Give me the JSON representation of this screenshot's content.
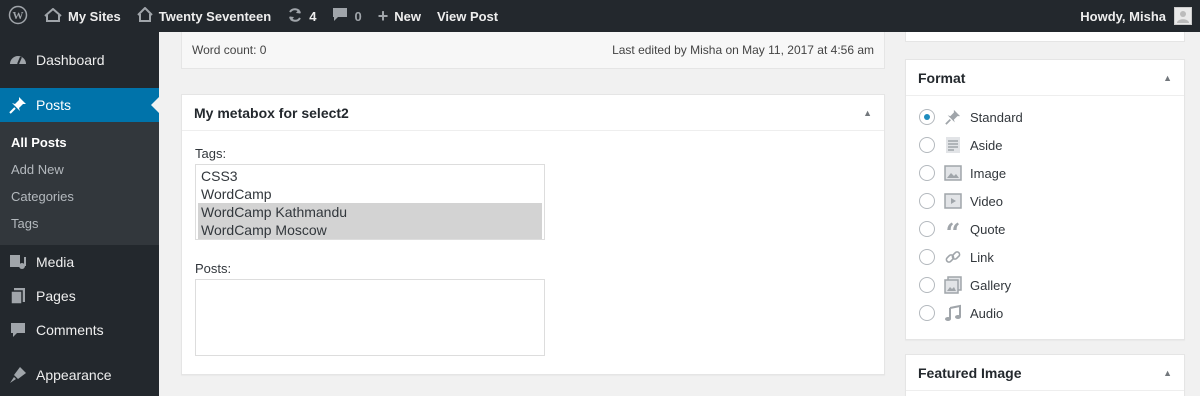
{
  "adminbar": {
    "wp_logo_icon": "wordpress-logo-icon",
    "my_sites": "My Sites",
    "site_name": "Twenty Seventeen",
    "updates_count": "4",
    "comments_count": "0",
    "new_label": "New",
    "view_post": "View Post",
    "howdy": "Howdy, Misha"
  },
  "sidebar": {
    "items": [
      {
        "label": "Dashboard",
        "icon": "dashboard-icon"
      },
      {
        "label": "Posts",
        "icon": "pushpin-icon"
      },
      {
        "label": "Media",
        "icon": "media-icon"
      },
      {
        "label": "Pages",
        "icon": "pages-icon"
      },
      {
        "label": "Comments",
        "icon": "comments-icon"
      },
      {
        "label": "Appearance",
        "icon": "appearance-icon"
      }
    ],
    "submenu": [
      "All Posts",
      "Add New",
      "Categories",
      "Tags"
    ]
  },
  "editor": {
    "word_count": "Word count: 0",
    "last_edited": "Last edited by Misha on May 11, 2017 at 4:56 am"
  },
  "metabox": {
    "title": "My metabox for select2",
    "tags_label": "Tags:",
    "tags_options": [
      "CSS3",
      "WordCamp",
      "WordCamp Kathmandu",
      "WordCamp Moscow"
    ],
    "tags_selected": [
      "WordCamp Kathmandu",
      "WordCamp Moscow"
    ],
    "posts_label": "Posts:"
  },
  "format": {
    "title": "Format",
    "options": [
      "Standard",
      "Aside",
      "Image",
      "Video",
      "Quote",
      "Link",
      "Gallery",
      "Audio"
    ],
    "selected": "Standard"
  },
  "featured": {
    "title": "Featured Image"
  },
  "colors": {
    "adminbar_bg": "#23282d",
    "accent": "#0073aa",
    "radio_dot": "#1e8cbe"
  }
}
